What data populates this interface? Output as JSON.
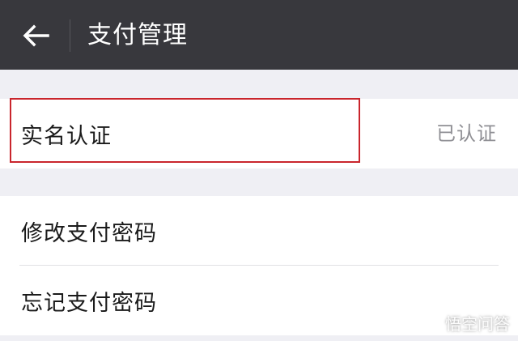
{
  "header": {
    "title": "支付管理",
    "back_icon": "back-arrow-icon"
  },
  "groups": [
    {
      "items": [
        {
          "label": "实名认证",
          "value": "已认证"
        }
      ]
    },
    {
      "items": [
        {
          "label": "修改支付密码"
        },
        {
          "label": "忘记支付密码"
        }
      ]
    }
  ],
  "highlight": {
    "color": "#c9252c"
  },
  "watermark": {
    "text": "悟空问答",
    "icon": "wukong-logo-icon"
  },
  "colors": {
    "topbar": "#38383d",
    "background": "#efeff4",
    "row_background": "#ffffff",
    "primary_text": "#1a1a1a",
    "secondary_text": "#8f8f94"
  }
}
